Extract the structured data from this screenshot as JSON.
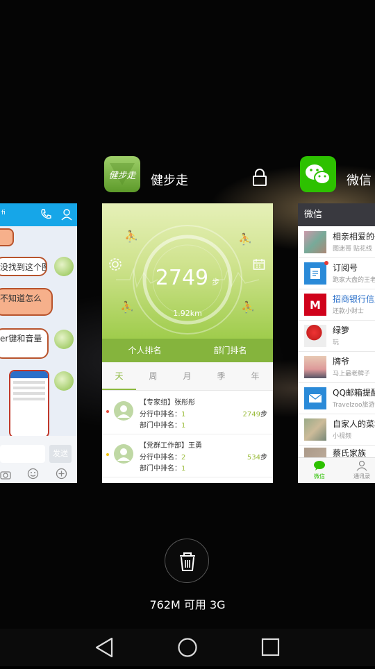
{
  "recents": {
    "apps": [
      {
        "name": "健步走",
        "icon": "jianbuzou-app-icon",
        "icon_text": "健步走"
      },
      {
        "name": "微信",
        "icon": "wechat-app-icon"
      }
    ],
    "lock_icon": "lock-icon"
  },
  "qq_card": {
    "header_text": "fi",
    "bubbles": [
      "没找到这个图",
      "不知道怎么",
      "er键和音量"
    ],
    "send_label": "发送"
  },
  "jianbuzou_card": {
    "steps": "2749",
    "steps_unit": "步",
    "distance": "1.92km",
    "tabs": [
      "个人排名",
      "部门排名"
    ],
    "periods": [
      "天",
      "周",
      "月",
      "季",
      "年"
    ],
    "rows": [
      {
        "group": "【专家组】张彤彤",
        "branch_label": "分行中排名：",
        "branch_rank": "1",
        "dept_label": "部门中排名：",
        "dept_rank": "1",
        "steps": "2749",
        "unit": "步"
      },
      {
        "group": "【党群工作部】王勇",
        "branch_label": "分行中排名：",
        "branch_rank": "2",
        "dept_label": "部门中排名：",
        "dept_rank": "1",
        "steps": "534",
        "unit": "步"
      }
    ]
  },
  "wechat_card": {
    "header": "微信",
    "chats": [
      {
        "title": "相亲相爱的一",
        "sub": "图迷哥 贴花线"
      },
      {
        "title": "订阅号",
        "sub": "跑家大盘的王老"
      },
      {
        "title": "招商银行信用",
        "sub": "还款小财士"
      },
      {
        "title": "绿箩",
        "sub": "玩"
      },
      {
        "title": "牌爷",
        "sub": "马上最老牌子"
      },
      {
        "title": "QQ邮箱提醒",
        "sub": "Travelzoo旅游"
      },
      {
        "title": "自家人的菜地",
        "sub": "小视频"
      },
      {
        "title": "蔡氏家族",
        "sub": ""
      }
    ],
    "bottom_tabs": [
      "微信",
      "通讯录"
    ]
  },
  "memory_status": "762M 可用  3G",
  "nav": {
    "back": "back-icon",
    "home": "home-icon",
    "recents": "recents-icon"
  }
}
